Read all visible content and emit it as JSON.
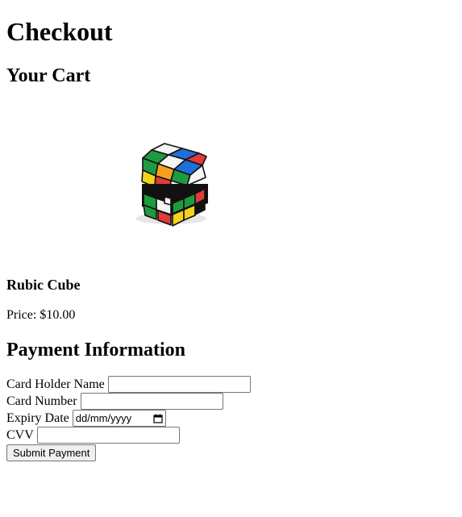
{
  "page": {
    "title": "Checkout"
  },
  "cart": {
    "heading": "Your Cart",
    "product": {
      "image": "rubiks-cube-image",
      "name": "Rubic Cube",
      "price_line": "Price: $10.00"
    }
  },
  "payment": {
    "heading": "Payment Information",
    "card_holder_label": "Card Holder Name",
    "card_holder_value": "",
    "card_number_label": "Card Number",
    "card_number_value": "",
    "expiry_label": "Expiry Date",
    "expiry_placeholder": "dd/mm/yyyy",
    "expiry_icon": "calendar-icon",
    "cvv_label": "CVV",
    "cvv_value": "",
    "submit_label": "Submit Payment"
  }
}
